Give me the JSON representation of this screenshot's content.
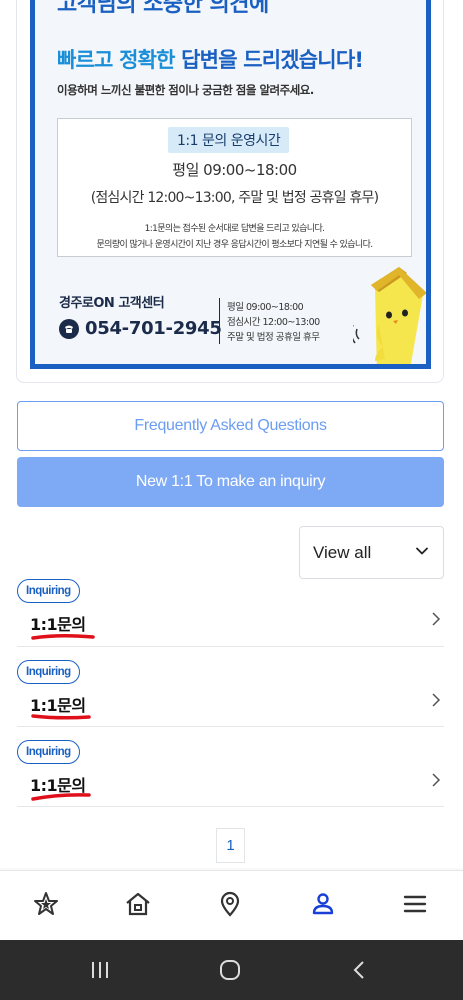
{
  "banner": {
    "partial_text": "고객님의 소중한 의견에",
    "headline_blue": "빠르고 정확한",
    "headline_dark": " 답변을 드리겠습니다!",
    "subline": "이용하며 느끼신 불편한 점이나 궁금한 점을 알려주세요.",
    "hours_title": "1:1 문의 운영시간",
    "hours_main": "평일 09:00~18:00",
    "hours_break": "(점심시간 12:00~13:00, 주말 및 법정 공휴일 휴무)",
    "note_1": "1:1문의는 접수된 순서대로 답변을 드리고 있습니다.",
    "note_2": "문의량이 많거나 운영시간이 지난 경우 응답시간이 평소보다 지연될 수 있습니다.",
    "center_name": "경주로ON 고객센터",
    "phone": "054-701-2945",
    "side_hours_1": "평일 09:00~18:00",
    "side_hours_2": "점심시간 12:00~13:00",
    "side_hours_3": "주말 및 법정 공휴일 휴무"
  },
  "buttons": {
    "faq": "Frequently Asked Questions",
    "new_inquiry": "New 1:1 To make an inquiry"
  },
  "filter": {
    "selected": "View all"
  },
  "inquiries": [
    {
      "status": "Inquiring",
      "title": "1:1문의"
    },
    {
      "status": "Inquiring",
      "title": "1:1문의"
    },
    {
      "status": "Inquiring",
      "title": "1:1문의"
    }
  ],
  "pagination": {
    "current": "1"
  },
  "bottom_nav": {
    "items": [
      "star-icon",
      "home-icon",
      "map-pin-icon",
      "user-icon",
      "menu-icon"
    ],
    "active": "user-icon"
  },
  "colors": {
    "brand_blue": "#1a60c2",
    "button_blue": "#7eaaf5",
    "outline_blue": "#6b9df2",
    "annotation_red": "#e0101a"
  }
}
